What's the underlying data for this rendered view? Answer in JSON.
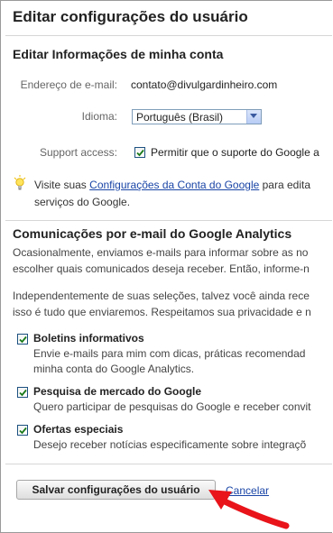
{
  "page": {
    "title": "Editar configurações do usuário"
  },
  "account_section": {
    "title": "Editar Informações de minha conta",
    "email_label": "Endereço de e-mail:",
    "email_value": "contato@divulgardinheiro.com",
    "language_label": "Idioma:",
    "language_value": "Português (Brasil)",
    "support_label": "Support access:",
    "support_checked": true,
    "support_text": "Permitir que o suporte do Google a",
    "tip_prefix": "Visite suas ",
    "tip_link": "Configurações da Conta do Google",
    "tip_suffix_line1": " para edita",
    "tip_line2": "serviços do Google."
  },
  "email_section": {
    "title": "Comunicações por e-mail do Google Analytics",
    "para1_line1": "Ocasionalmente, enviamos e-mails para informar sobre as no",
    "para1_line2": "escolher quais comunicados deseja receber. Então, informe-n",
    "para2_line1": "Independentemente de suas seleções, talvez você ainda rece",
    "para2_line2": "isso é tudo que enviaremos. Respeitamos sua privacidade e n",
    "options": [
      {
        "title": "Boletins informativos",
        "desc_line1": "Envie e-mails para mim com dicas, práticas recomendad",
        "desc_line2": "minha conta do Google Analytics.",
        "checked": true
      },
      {
        "title": "Pesquisa de mercado do Google",
        "desc_line1": "Quero participar de pesquisas do Google e receber convit",
        "desc_line2": "",
        "checked": true
      },
      {
        "title": "Ofertas especiais",
        "desc_line1": "Desejo receber notícias especificamente sobre integraçõ",
        "desc_line2": "",
        "checked": true
      }
    ]
  },
  "actions": {
    "save_label": "Salvar configurações do usuário",
    "cancel_label": "Cancelar"
  },
  "colors": {
    "link": "#1a45a6",
    "arrow": "#e8141a",
    "checkmark": "#1a7a1a"
  },
  "icons": {
    "tip": "lightbulb-icon",
    "check": "checkmark-icon",
    "dropdown": "chevron-down-icon",
    "annotation": "red-arrow-icon"
  }
}
